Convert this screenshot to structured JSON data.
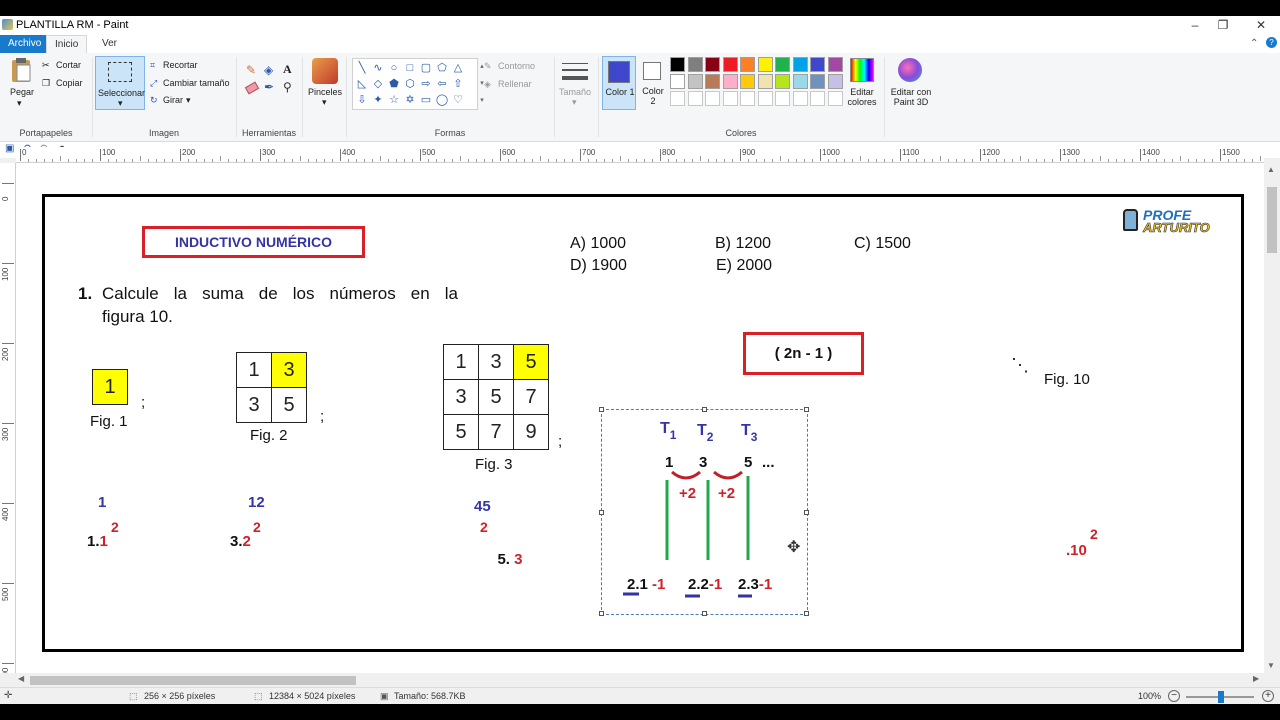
{
  "window": {
    "title": "PLANTILLA RM - Paint",
    "minimize": "–",
    "maximize": "❐",
    "close": "✕"
  },
  "menu": {
    "file": "Archivo",
    "home": "Inicio",
    "view": "Ver"
  },
  "ribbon": {
    "clipboard": {
      "paste": "Pegar",
      "cut": "Cortar",
      "copy": "Copiar",
      "label": "Portapapeles"
    },
    "image": {
      "select": "Seleccionar",
      "crop": "Recortar",
      "resize": "Cambiar tamaño",
      "rotate": "Girar",
      "label": "Imagen"
    },
    "tools": {
      "label": "Herramientas"
    },
    "brushes": {
      "label": "Pinceles"
    },
    "shapes": {
      "outline": "Contorno",
      "fill": "Rellenar",
      "label": "Formas"
    },
    "size": {
      "label": "Tamaño"
    },
    "colors": {
      "color1": "Color 1",
      "color2": "Color 2",
      "edit": "Editar colores",
      "paint3d": "Editar con Paint 3D",
      "label": "Colores",
      "color1_value": "#3f48cc",
      "color2_value": "#ffffff",
      "palette": [
        "#000000",
        "#7f7f7f",
        "#880015",
        "#ed1c24",
        "#ff7f27",
        "#fff200",
        "#22b14c",
        "#00a2e8",
        "#3f48cc",
        "#a349a4",
        "#ffffff",
        "#c3c3c3",
        "#b97a57",
        "#ffaec9",
        "#ffc90e",
        "#efe4b0",
        "#b5e61d",
        "#99d9ea",
        "#7092be",
        "#c8bfe7"
      ]
    }
  },
  "ruler": {
    "h_ticks": [
      "0",
      "100",
      "200",
      "300",
      "400",
      "500",
      "600",
      "700",
      "800",
      "900",
      "1000",
      "1100",
      "1200",
      "1300",
      "1400",
      "1500"
    ],
    "v_ticks": [
      "0",
      "100",
      "200",
      "300",
      "400",
      "500",
      "600"
    ]
  },
  "slide": {
    "title": "INDUCTIVO NUMÉRICO",
    "logo_top": "PROFE",
    "logo_bottom": "ARTURITO",
    "question_number": "1.",
    "question_line1": "Calcule la suma de los números en la",
    "question_line2": "figura 10.",
    "answers": {
      "a": "A) 1000",
      "b": "B) 1200",
      "c": "C) 1500",
      "d": "D) 1900",
      "e": "E) 2000"
    },
    "formula": "( 2n - 1 )",
    "fig1": {
      "cells": [
        "1"
      ],
      "label": "Fig. 1",
      "sep": ";"
    },
    "fig2": {
      "cells": [
        "1",
        "3",
        "3",
        "5"
      ],
      "label": "Fig. 2",
      "sep": ";"
    },
    "fig3": {
      "cells": [
        "1",
        "3",
        "5",
        "3",
        "5",
        "7",
        "5",
        "7",
        "9"
      ],
      "label": "Fig. 3",
      "sep": ";"
    },
    "ellipsis": "⋱",
    "fig10_label": "Fig. 10",
    "sums": [
      "1",
      "12",
      "45"
    ],
    "powers": [
      {
        "coef": "1.",
        "base": "1",
        "exp": "2"
      },
      {
        "coef": "3.",
        "base": "2",
        "exp": "2"
      },
      {
        "coef": "5. ",
        "base": "3",
        "exp": "2"
      },
      {
        "coef": "",
        "base": ".10",
        "exp": "2"
      }
    ],
    "selection": {
      "t1": "T",
      "t1s": "1",
      "t2": "T",
      "t2s": "2",
      "t3": "T",
      "t3s": "3",
      "n1": "1",
      "n2": "3",
      "n3": "5",
      "dots": "...",
      "plus1": "+2",
      "plus2": "+2",
      "e1a": "2.1",
      "e1b": " -1",
      "e2a": "2.2",
      "e2b": "-1",
      "e3a": "2.3",
      "e3b": "-1"
    }
  },
  "status": {
    "selection_size": "256 × 256 píxeles",
    "image_size": "12384 × 5024 píxeles",
    "file_size": "Tamaño: 568.7KB",
    "zoom": "100%"
  }
}
